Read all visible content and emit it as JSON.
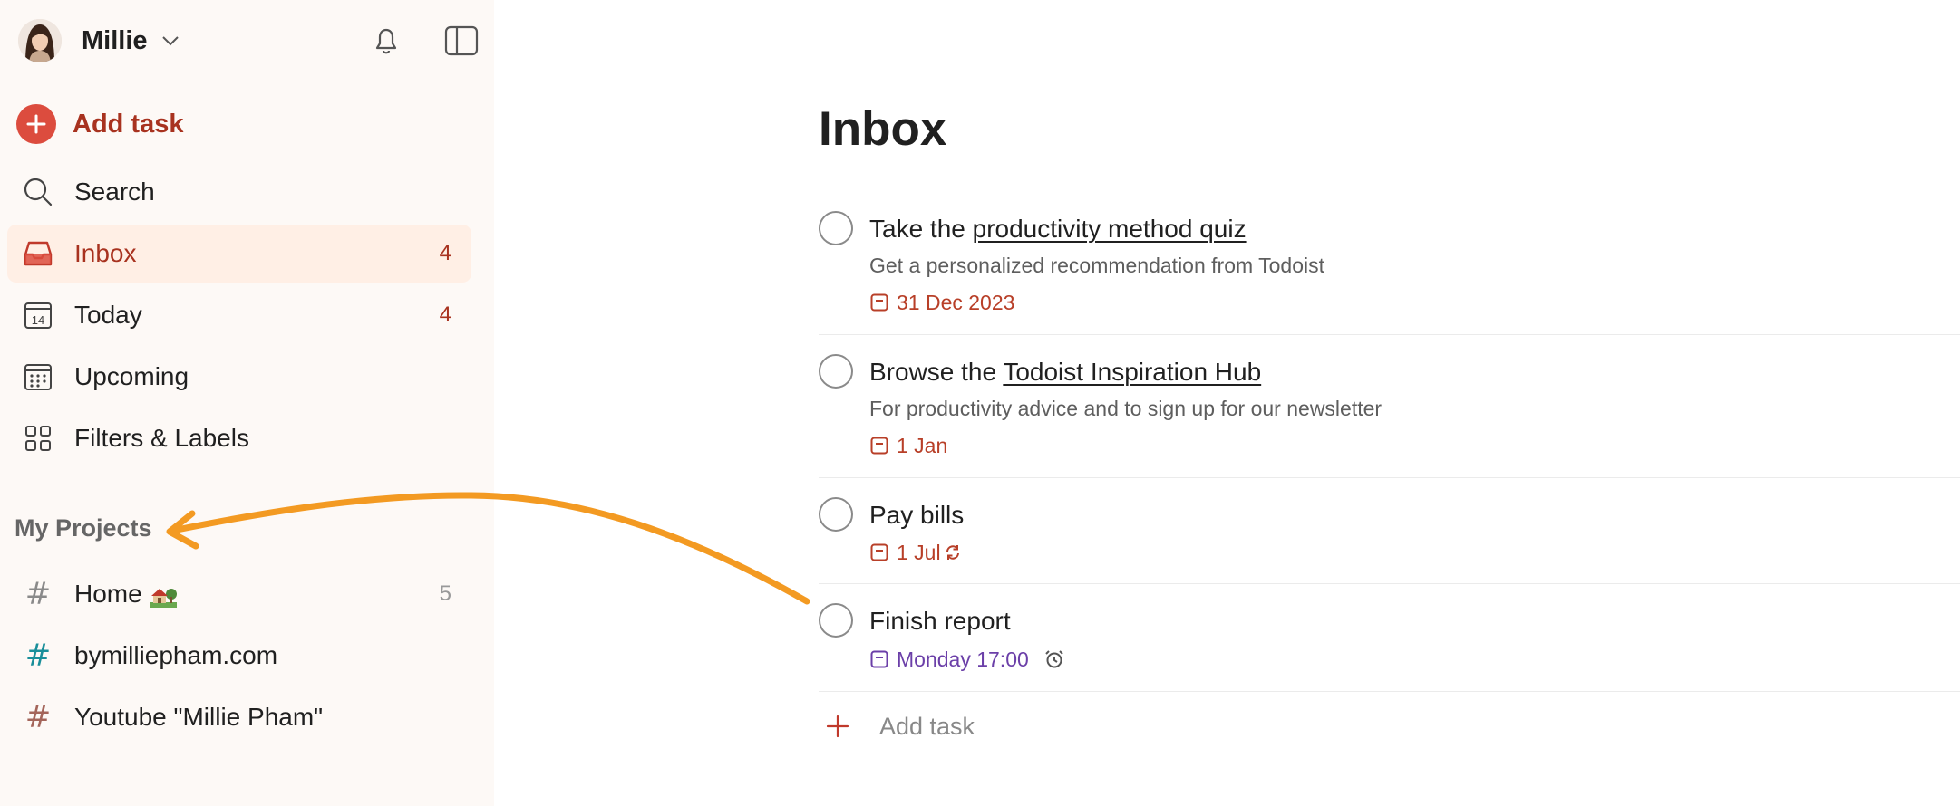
{
  "user": {
    "name": "Millie"
  },
  "sidebar": {
    "add_task_label": "Add task",
    "nav": [
      {
        "label": "Search",
        "icon": "search-icon",
        "count": ""
      },
      {
        "label": "Inbox",
        "icon": "inbox-icon",
        "count": "4",
        "active": true
      },
      {
        "label": "Today",
        "icon": "calendar-today-icon",
        "count": "4",
        "day": "14"
      },
      {
        "label": "Upcoming",
        "icon": "calendar-grid-icon",
        "count": ""
      },
      {
        "label": "Filters & Labels",
        "icon": "grid-icon",
        "count": ""
      }
    ],
    "projects_title": "My Projects",
    "projects": [
      {
        "label": "Home",
        "count": "5",
        "hash_color": "#8a8a8a",
        "emoji": "house-with-garden-icon"
      },
      {
        "label": "bymilliepham.com",
        "count": "",
        "hash_color": "#1a8f9a"
      },
      {
        "label": "Youtube \"Millie Pham\"",
        "count": "",
        "hash_color": "#a4655a"
      }
    ]
  },
  "main": {
    "title": "Inbox",
    "tasks": [
      {
        "title_prefix": "Take the ",
        "title_link": "productivity method quiz",
        "description": "Get a personalized recommendation from Todoist",
        "date": "31 Dec 2023",
        "date_color": "red"
      },
      {
        "title_prefix": "Browse the ",
        "title_link": "Todoist Inspiration Hub",
        "description": "For productivity advice and to sign up for our newsletter",
        "date": "1 Jan",
        "date_color": "red"
      },
      {
        "title_prefix": "Pay bills",
        "title_link": "",
        "description": "",
        "date": "1 Jul",
        "date_color": "red",
        "recurring": true
      },
      {
        "title_prefix": "Finish report",
        "title_link": "",
        "description": "",
        "date": "Monday 17:00",
        "date_color": "purple",
        "reminder": true
      }
    ],
    "add_task_label": "Add task"
  },
  "colors": {
    "accent": "#dc4c3e",
    "accent_text": "#a8321f",
    "sidebar_bg": "#fdf9f6",
    "active_bg": "#ffefe5",
    "annotation_arrow": "#f39a22",
    "date_red": "#b83f28",
    "date_purple": "#6b3fa8"
  }
}
